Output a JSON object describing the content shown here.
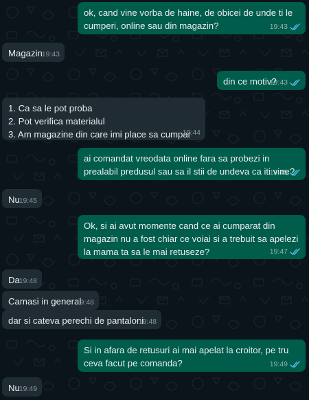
{
  "colors": {
    "background": "#0b141a",
    "outgoing_bubble": "#005c4b",
    "incoming_bubble": "#202c33",
    "read_ticks": "#53bdeb"
  },
  "messages": [
    {
      "dir": "out",
      "text": "ok, cand vine vorba de haine, de obicei de unde ti le cumperi, online sau din magazin?",
      "time": "19:43",
      "status_icon": "double-check-read-icon"
    },
    {
      "dir": "in",
      "text": "Magazin",
      "time": "19:43"
    },
    {
      "dir": "out",
      "text": "din ce motiv?",
      "time": "19:43",
      "status_icon": "double-check-read-icon"
    },
    {
      "dir": "in",
      "text": "1. Ca sa le pot proba\n2. Pot verifica materialul\n3. Am magazine din care imi place sa cumpar",
      "time": "19:44"
    },
    {
      "dir": "out",
      "text": "ai comandat vreodata online fara sa probezi in prealabil predusul sau sa il stii de undeva ca iti vine?",
      "time": "19:45",
      "status_icon": "double-check-read-icon"
    },
    {
      "dir": "in",
      "text": "Nu",
      "time": "19:45"
    },
    {
      "dir": "out",
      "text": "Ok, si ai avut momente cand ce ai cumparat din magazin nu a fost chiar ce voiai si a trebuit sa apelezi la mama ta sa le mai retuseze?",
      "time": "19:47",
      "status_icon": "double-check-read-icon"
    },
    {
      "dir": "in",
      "text": "Da",
      "time": "19:48"
    },
    {
      "dir": "in",
      "text": "Camasi in general",
      "time": "19:48"
    },
    {
      "dir": "in",
      "text": "dar si cateva perechi de pantaloni",
      "time": "19:48"
    },
    {
      "dir": "out",
      "text": "Si in afara de retusuri ai mai apelat la croitor, pe tru ceva facut pe comanda?",
      "time": "19:49",
      "status_icon": "double-check-read-icon"
    },
    {
      "dir": "in",
      "text": "Nu",
      "time": "19:49"
    }
  ]
}
